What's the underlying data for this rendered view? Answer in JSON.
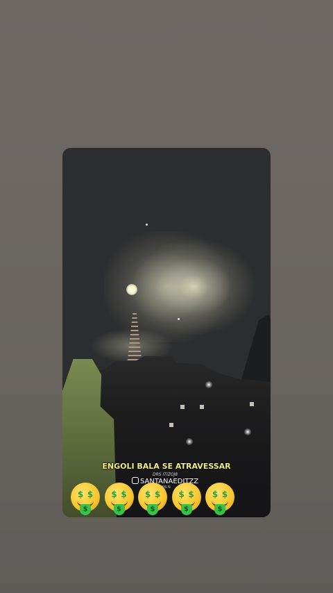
{
  "caption": {
    "title": "ENGOLI BALA SE ATRAVESSAR",
    "small_tag": "DRS ITIZOJ8",
    "credit": "SANTANAEDITZZ",
    "credit_icon": "instagram-icon",
    "mais": "MAIS N"
  },
  "emoji_row": [
    {
      "icon": "money-mouth-face-icon",
      "eye": "$",
      "tongue": "$"
    },
    {
      "icon": "money-mouth-face-icon",
      "eye": "$",
      "tongue": "$"
    },
    {
      "icon": "money-mouth-face-icon",
      "eye": "$",
      "tongue": "$"
    },
    {
      "icon": "money-mouth-face-icon",
      "eye": "$",
      "tongue": "$"
    },
    {
      "icon": "money-mouth-face-icon",
      "eye": "$",
      "tongue": "$"
    }
  ],
  "colors": {
    "background": "#6b6662",
    "caption_title": "#f5ef7a",
    "jacket": "#5f6d3d"
  }
}
